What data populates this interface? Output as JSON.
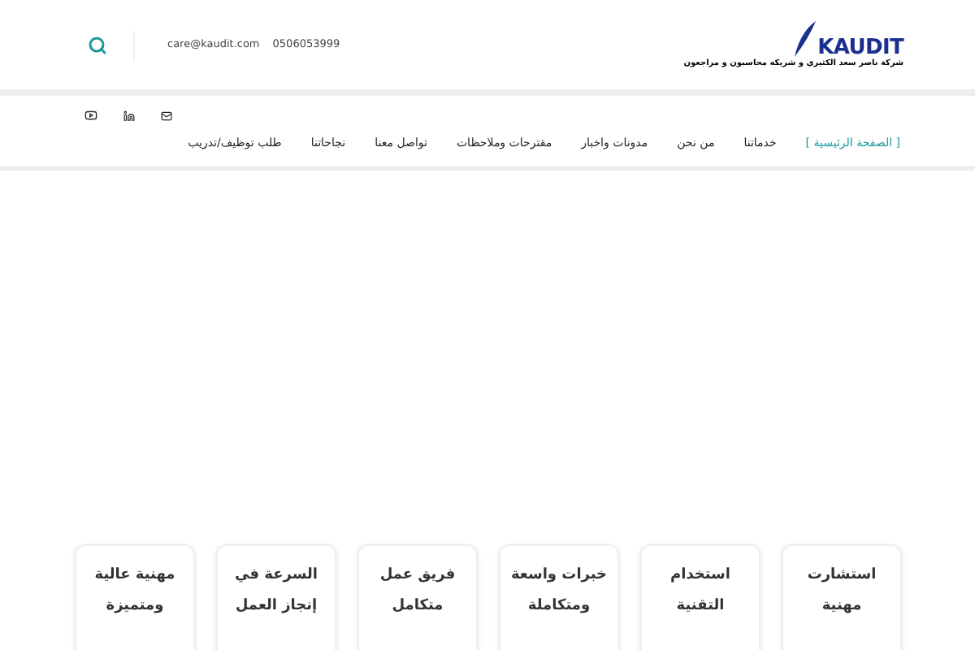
{
  "header": {
    "logo": {
      "wordmark": "KAUDIT",
      "tagline": "شركة ناصر سعد الكثيري و شريكه محاسبون و مراجعون"
    },
    "email": "care@kaudit.com",
    "phone": "0506053999"
  },
  "nav": {
    "items": [
      {
        "label": "[ الصفحة الرئيسية ]",
        "selected": true
      },
      {
        "label": "خدماتنا",
        "selected": false
      },
      {
        "label": "من نحن",
        "selected": false
      },
      {
        "label": "مدونات واخبار",
        "selected": false
      },
      {
        "label": "مقترحات وملاحظات",
        "selected": false
      },
      {
        "label": "تواصل معنا",
        "selected": false
      },
      {
        "label": "نجاحاتنا",
        "selected": false
      },
      {
        "label": "طلب توظيف/تدريب",
        "selected": false
      }
    ]
  },
  "features": [
    {
      "lines": [
        "استشارت",
        "مهنية"
      ]
    },
    {
      "lines": [
        "استخدام",
        "التقنية"
      ]
    },
    {
      "lines": [
        "خبرات واسعة",
        "ومتكاملة"
      ]
    },
    {
      "lines": [
        "فريق عمل",
        "متكامل"
      ]
    },
    {
      "lines": [
        "السرعة في",
        "إنجاز العمل"
      ]
    },
    {
      "lines": [
        "مهنية عالية",
        "ومتميزة"
      ]
    }
  ]
}
